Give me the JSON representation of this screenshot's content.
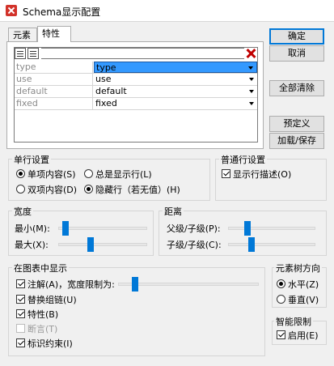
{
  "window": {
    "title": "Schema显示配置"
  },
  "tabs": [
    {
      "label": "元素"
    },
    {
      "label": "特性"
    }
  ],
  "attributes_list": {
    "rows": [
      {
        "name": "type",
        "value": "type"
      },
      {
        "name": "use",
        "value": "use"
      },
      {
        "name": "default",
        "value": "default"
      },
      {
        "name": "fixed",
        "value": "fixed"
      }
    ]
  },
  "buttons": {
    "ok": "确定",
    "cancel": "取消",
    "clear_all": "全部清除",
    "predefined": "预定义",
    "load_save": "加载/保存"
  },
  "single_line": {
    "title": "单行设置",
    "single_content": "单项内容(S)",
    "always_show": "总是显示行(L)",
    "double_content": "双项内容(D)",
    "hide_row": "隐藏行（若无值）(H)"
  },
  "general_line": {
    "title": "普通行设置",
    "show_desc": "显示行描述(O)"
  },
  "width": {
    "title": "宽度",
    "min_label": "最小(M):",
    "max_label": "最大(X):",
    "min_value": 0.05,
    "max_value": 0.35
  },
  "distance": {
    "title": "距离",
    "parent_child_label": "父级/子级(P):",
    "child_child_label": "子级/子级(C):",
    "parent_child_value": 0.2,
    "child_child_value": 0.25
  },
  "display_in_diagram": {
    "title": "在图表中显示",
    "annotation": "注解(A)，宽度限制为:",
    "annotation_width_value": 0.1,
    "substitution_groups": "替换组链(U)",
    "attributes": "特性(B)",
    "assertions": "断言(T)",
    "identity_constraints": "标识约束(I)"
  },
  "tree_direction": {
    "title": "元素树方向",
    "horizontal": "水平(Z)",
    "vertical": "垂直(V)"
  },
  "smart_restriction": {
    "title": "智能限制",
    "enable": "启用(E)"
  },
  "colors": {
    "accent": "#0078d7",
    "selection": "#3399ff",
    "delete": "#c00000"
  }
}
